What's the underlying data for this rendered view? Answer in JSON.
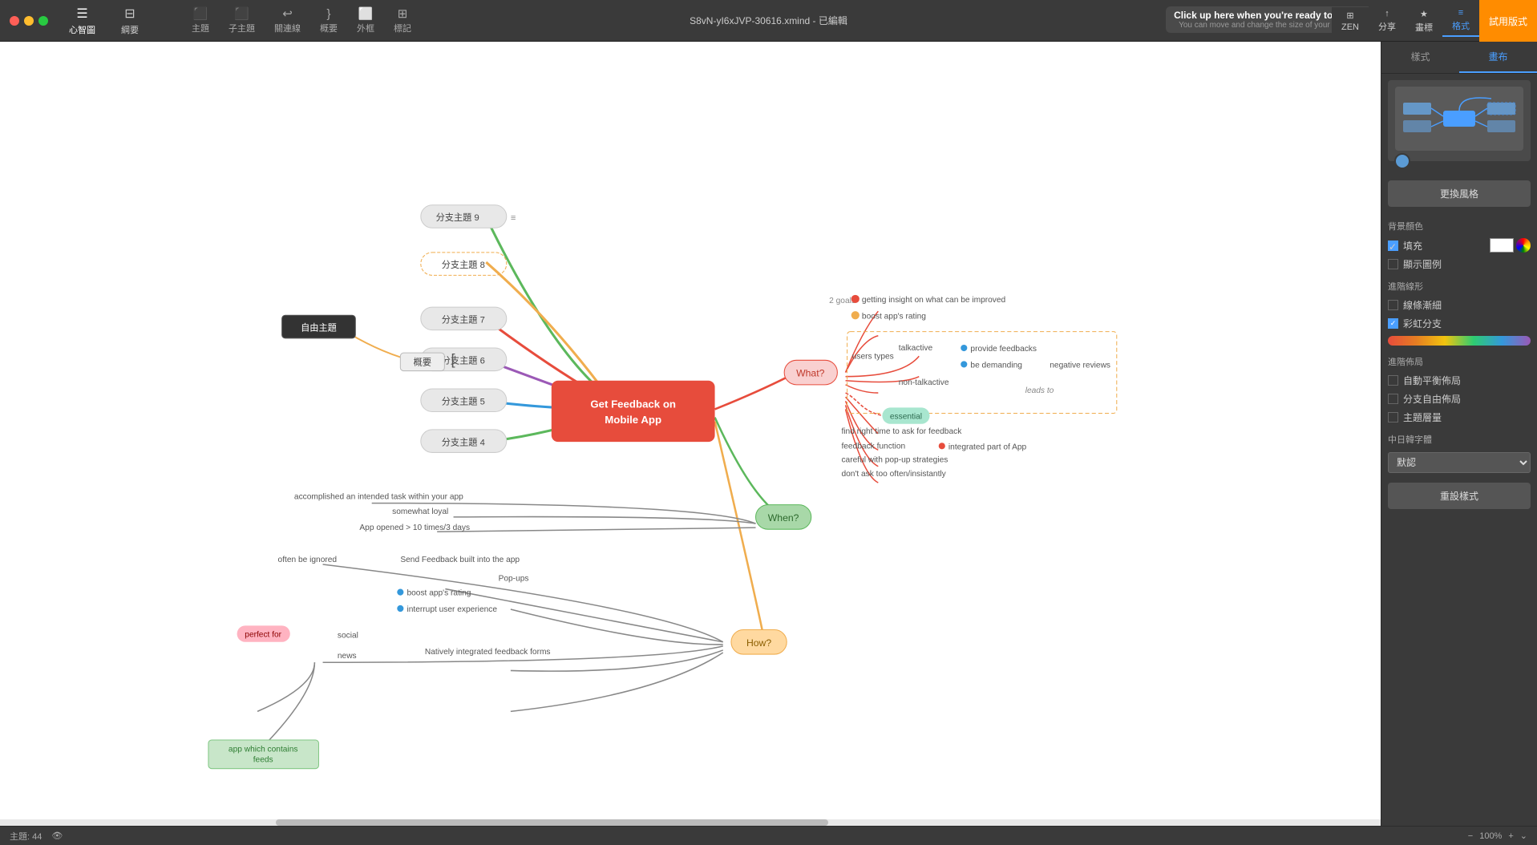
{
  "window": {
    "title": "S8vN-yI6xJVP-30616.xmind - 已編輯"
  },
  "titlebar": {
    "nav": [
      {
        "id": "mindmap",
        "icon": "☰",
        "label": "心智圖"
      },
      {
        "id": "outline",
        "icon": "☰",
        "label": "綱要"
      }
    ],
    "tools": [
      {
        "id": "topic",
        "icon": "⬛",
        "label": "主題"
      },
      {
        "id": "subtopic",
        "icon": "⬛",
        "label": "子主題"
      },
      {
        "id": "connection",
        "icon": "↩",
        "label": "關連線"
      },
      {
        "id": "summary",
        "icon": "}",
        "label": "概要"
      },
      {
        "id": "boundary",
        "icon": "⬜",
        "label": "外框"
      },
      {
        "id": "mark",
        "icon": "⊞",
        "label": "標記"
      }
    ],
    "zen": "ZEN",
    "share": "分享",
    "record_title": "Click up here when you're ready to record!",
    "record_sub": "You can move and change the size of your selection",
    "right_btns": [
      {
        "id": "bookmark",
        "icon": "★",
        "label": "畫標"
      },
      {
        "id": "format",
        "icon": "≡",
        "label": "格式"
      }
    ],
    "trial_btn": "試用版式"
  },
  "right_panel": {
    "tabs": [
      "樣式",
      "畫布"
    ],
    "active_tab": 1,
    "change_style_btn": "更換風格",
    "sections": {
      "background_color": "背景顏色",
      "fill_label": "填充",
      "show_image_label": "顯示圖例",
      "advanced_shape": "進階線形",
      "taper_label": "線條漸細",
      "rainbow_label": "彩虹分支",
      "advanced_layout": "進階佈局",
      "auto_balance": "自動平衡佈局",
      "free_branch": "分支自由佈局",
      "topic_level": "主題層量",
      "cjk_font": "中日韓字體",
      "default_font": "默認",
      "reset_btn": "重設樣式"
    },
    "checkboxes": {
      "fill": true,
      "show_image": false,
      "taper": false,
      "rainbow": true,
      "auto_balance": false,
      "free_branch": false,
      "topic_level": false
    }
  },
  "statusbar": {
    "topic_count_label": "主題: 44",
    "zoom_level": "100%"
  },
  "mindmap": {
    "central_node": "Get Feedback on Mobile App",
    "free_node": "自由主題",
    "overview_node": "概要",
    "branches": [
      {
        "id": "sub9",
        "label": "分支主題 9"
      },
      {
        "id": "sub8",
        "label": "分支主題 8"
      },
      {
        "id": "sub7",
        "label": "分支主題 7"
      },
      {
        "id": "sub6",
        "label": "分支主題 6"
      },
      {
        "id": "sub5",
        "label": "分支主題 5"
      },
      {
        "id": "sub4",
        "label": "分支主題 4"
      }
    ],
    "what_branch": {
      "label": "What?",
      "goals_label": "2 goals",
      "goal1": "getting insight on what can be improved",
      "goal2": "boost app's rating",
      "users_types": "users types",
      "talkactive": "talkactive",
      "non_talkactive": "non-talkactive",
      "provide_feedbacks": "provide feedbacks",
      "be_demanding": "be demanding",
      "negative_reviews": "negative reviews",
      "leads_to": "leads to",
      "essential": "essential",
      "find_right_time": "find right time to ask for feedback",
      "feedback_function": "feedback function",
      "integrated_part": "integrated part of App",
      "careful_popup": "careful with pop-up strategies",
      "dont_ask": "don't ask too often/insistantly"
    },
    "when_branch": {
      "label": "When?",
      "item1": "accomplished an intended task within your app",
      "item2": "somewhat loyal",
      "item3": "App opened > 10 times/3 days"
    },
    "how_branch": {
      "label": "How?",
      "item1": "often be ignored",
      "item2": "Send Feedback built into the app",
      "popups": "Pop-ups",
      "boost_rating": "boost app's rating",
      "interrupt_ux": "interrupt user experience",
      "social": "social",
      "news": "news",
      "natively_integrated": "Natively integrated feedback forms",
      "perfect_for": "perfect for",
      "app_contains_feeds": "app which contains feeds"
    }
  }
}
